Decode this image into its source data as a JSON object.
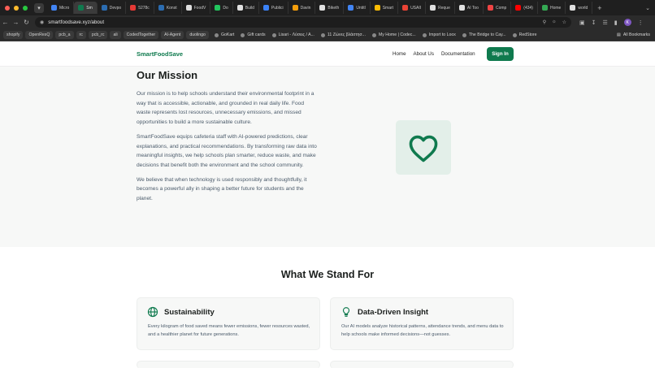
{
  "browser": {
    "tabs": [
      {
        "label": "Micro",
        "color": "#4285f4"
      },
      {
        "label": "Sm",
        "color": "#0f7a4e",
        "active": true
      },
      {
        "label": "Devpo",
        "color": "#2b6cb0"
      },
      {
        "label": "5278c",
        "color": "#e53935"
      },
      {
        "label": "Konst",
        "color": "#2b6cb0"
      },
      {
        "label": "FoodV",
        "color": "#e0e0e0"
      },
      {
        "label": "Do",
        "color": "#22c55e"
      },
      {
        "label": "Build",
        "color": "#e0e0e0"
      },
      {
        "label": "Publici",
        "color": "#3b82f6"
      },
      {
        "label": "Davin",
        "color": "#f59e0b"
      },
      {
        "label": "Biketh",
        "color": "#e0e0e0"
      },
      {
        "label": "Untitl",
        "color": "#4285f4"
      },
      {
        "label": "Smart",
        "color": "#fbbc04"
      },
      {
        "label": "USAII",
        "color": "#ea4335"
      },
      {
        "label": "Reque",
        "color": "#e0e0e0"
      },
      {
        "label": "AI Too",
        "color": "#e0e0e0"
      },
      {
        "label": "Comp",
        "color": "#ef4444"
      },
      {
        "label": "(434)",
        "color": "#ff0000"
      },
      {
        "label": "Home",
        "color": "#34a853"
      },
      {
        "label": "world",
        "color": "#e0e0e0"
      }
    ],
    "url": "smartfoodsave.xyz/about",
    "profile_initial": "K",
    "bookmarks": [
      {
        "label": "shopify",
        "chip": true
      },
      {
        "label": "OpenResQ",
        "chip": true
      },
      {
        "label": "pcb_a",
        "chip": true
      },
      {
        "label": "rc",
        "chip": true
      },
      {
        "label": "pcb_rc",
        "chip": true
      },
      {
        "label": "ali",
        "chip": true
      },
      {
        "label": "CodedTogether",
        "chip": true
      },
      {
        "label": "AI-Agent",
        "chip": true
      },
      {
        "label": "duolingo",
        "chip": true
      },
      {
        "label": "GoKart",
        "chip": false
      },
      {
        "label": "Gift cards",
        "chip": false
      },
      {
        "label": "Lisari - Λύσεις / Α...",
        "chip": false
      },
      {
        "label": "11 Ζώνες βλάστησ...",
        "chip": false
      },
      {
        "label": "My Home | Codec...",
        "chip": false
      },
      {
        "label": "Import to Loox",
        "chip": false
      },
      {
        "label": "The Bridge to Cay...",
        "chip": false
      },
      {
        "label": "RedStore",
        "chip": false
      }
    ],
    "all_bookmarks_label": "All Bookmarks"
  },
  "site": {
    "brand": "SmartFoodSave",
    "nav": [
      "Home",
      "About Us",
      "Documentation"
    ],
    "signin_label": "Sign In",
    "accent_color": "#0f7a4e"
  },
  "mission": {
    "title": "Our Mission",
    "paragraphs": [
      "Our mission is to help schools understand their environmental footprint in a way that is accessible, actionable, and grounded in real daily life. Food waste represents lost resources, unnecessary emissions, and missed opportunities to build a more sustainable culture.",
      "SmartFoodSave equips cafeteria staff with AI-powered predictions, clear explanations, and practical recommendations. By transforming raw data into meaningful insights, we help schools plan smarter, reduce waste, and make decisions that benefit both the environment and the school community.",
      "We believe that when technology is used responsibly and thoughtfully, it becomes a powerful ally in shaping a better future for students and the planet."
    ],
    "illustration_icon": "heart-icon"
  },
  "values": {
    "title": "What We Stand For",
    "cards": [
      {
        "icon": "globe-icon",
        "title": "Sustainability",
        "text": "Every kilogram of food saved means fewer emissions, fewer resources wasted, and a healthier planet for future generations."
      },
      {
        "icon": "lightbulb-icon",
        "title": "Data-Driven Insight",
        "text": "Our AI models analyze historical patterns, attendance trends, and menu data to help schools make informed decisions—not guesses."
      }
    ]
  }
}
